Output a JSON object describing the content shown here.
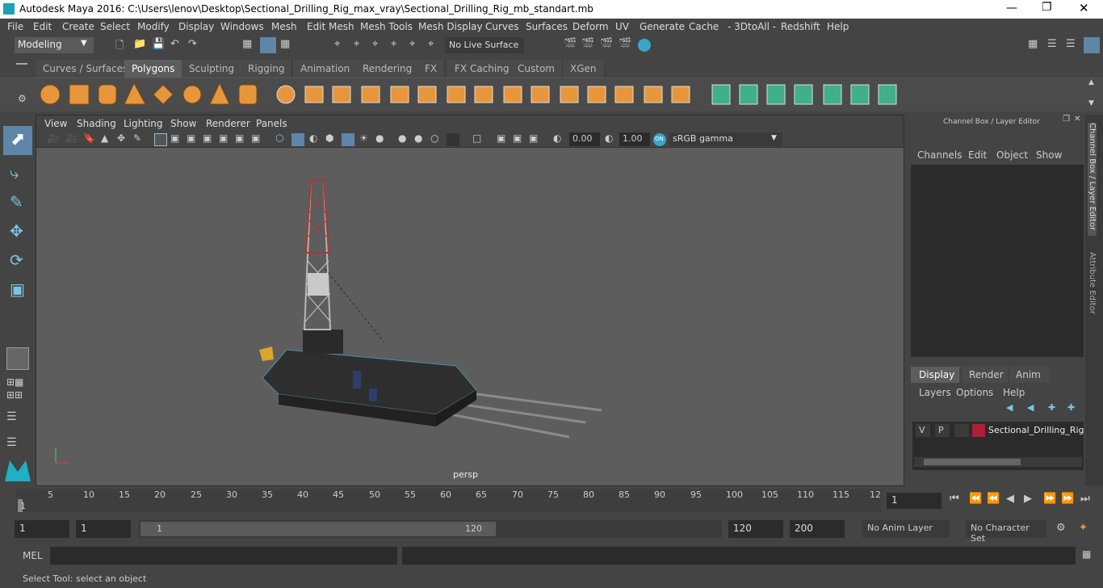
{
  "window": {
    "title": "Autodesk Maya 2016: C:\\Users\\lenov\\Desktop\\Sectional_Drilling_Rig_max_vray\\Sectional_Drilling_Rig_mb_standart.mb"
  },
  "menus": [
    "File",
    "Edit",
    "Create",
    "Select",
    "Modify",
    "Display",
    "Windows",
    "Mesh",
    "Edit Mesh",
    "Mesh Tools",
    "Mesh Display",
    "Curves",
    "Surfaces",
    "Deform",
    "UV",
    "Generate",
    "Cache",
    "- 3DtoAll -",
    "Redshift",
    "Help"
  ],
  "toolbar": {
    "mode": "Modeling",
    "live_surface": "No Live Surface"
  },
  "shelf_tabs": [
    "Curves / Surfaces",
    "Polygons",
    "Sculpting",
    "Rigging",
    "Animation",
    "Rendering",
    "FX",
    "FX Caching",
    "Custom",
    "XGen"
  ],
  "shelf_active": "Polygons",
  "viewport": {
    "menus": [
      "View",
      "Shading",
      "Lighting",
      "Show",
      "Renderer",
      "Panels"
    ],
    "exposure": "0.00",
    "gamma": "1.00",
    "color_space": "sRGB gamma",
    "camera_label": "persp"
  },
  "channel_box": {
    "title": "Channel Box / Layer Editor",
    "menus": [
      "Channels",
      "Edit",
      "Object",
      "Show"
    ]
  },
  "layer_editor": {
    "tabs": [
      "Display",
      "Render",
      "Anim"
    ],
    "menus": [
      "Layers",
      "Options",
      "Help"
    ],
    "layer": {
      "v": "V",
      "p": "P",
      "name": "Sectional_Drilling_Rig",
      "color": "#b01e3a"
    }
  },
  "side_tabs": [
    "Channel Box / Layer Editor",
    "Attribute Editor"
  ],
  "timeline": {
    "ticks": [
      "5",
      "10",
      "15",
      "20",
      "25",
      "30",
      "35",
      "40",
      "45",
      "50",
      "55",
      "60",
      "65",
      "70",
      "75",
      "80",
      "85",
      "90",
      "95",
      "100",
      "105",
      "110",
      "115",
      "12"
    ],
    "start_label": "1",
    "current_frame": "1"
  },
  "range": {
    "start": "1",
    "start2": "1",
    "slider_start": "1",
    "slider_end": "120",
    "end": "120",
    "end2": "200",
    "anim_layer": "No Anim Layer",
    "char_set": "No Character Set"
  },
  "cmd": {
    "label": "MEL"
  },
  "help_line": "Select Tool: select an object"
}
